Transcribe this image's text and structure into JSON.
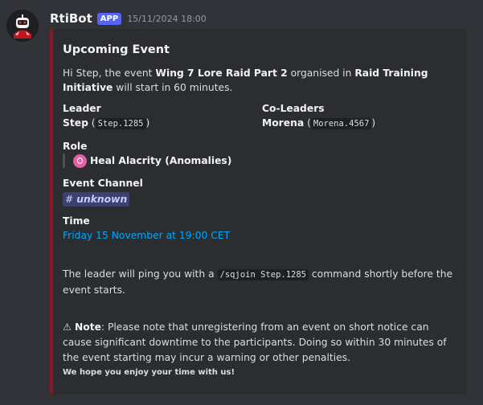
{
  "message": {
    "username": "RtiBot",
    "badge": "APP",
    "timestamp": "15/11/2024 18:00",
    "avatar_icon": "robot-icon"
  },
  "embed": {
    "accent_color": "#8b1624",
    "title": "Upcoming Event",
    "desc_greeting": "Hi Step, the event ",
    "event_name": "Wing 7 Lore Raid Part 2",
    "desc_mid": " organised in ",
    "org_name": "Raid Training Initiative",
    "desc_end": " will start in 60 minutes.",
    "leader_label": "Leader",
    "leader_name": "Step",
    "leader_open": " (",
    "leader_handle": "Step.1285",
    "leader_close": ")",
    "coleaders_label": "Co-Leaders",
    "coleader_name": "Morena",
    "coleader_open": " (",
    "coleader_handle": "Morena.4567",
    "coleader_close": ")",
    "role_label": "Role",
    "role_icon": "heal-role-icon",
    "role_value": "Heal Alacrity (Anomalies)",
    "channel_label": "Event Channel",
    "channel_hash": "#",
    "channel_value": "unknown",
    "time_label": "Time",
    "time_value": "Friday 15 November at 19:00 CET",
    "ping_before": "The leader will ping you with a ",
    "ping_command": "/sqjoin Step.1285",
    "ping_after": " command shortly before the event starts.",
    "note_icon": "warning-icon",
    "note_label": "Note",
    "note_text": ": Please note that unregistering from an event on short notice can cause significant downtime to the participants. Doing so within 30 minutes of the event starting may incur a warning or other penalties.",
    "footer": "We hope you enjoy your time with us!"
  }
}
